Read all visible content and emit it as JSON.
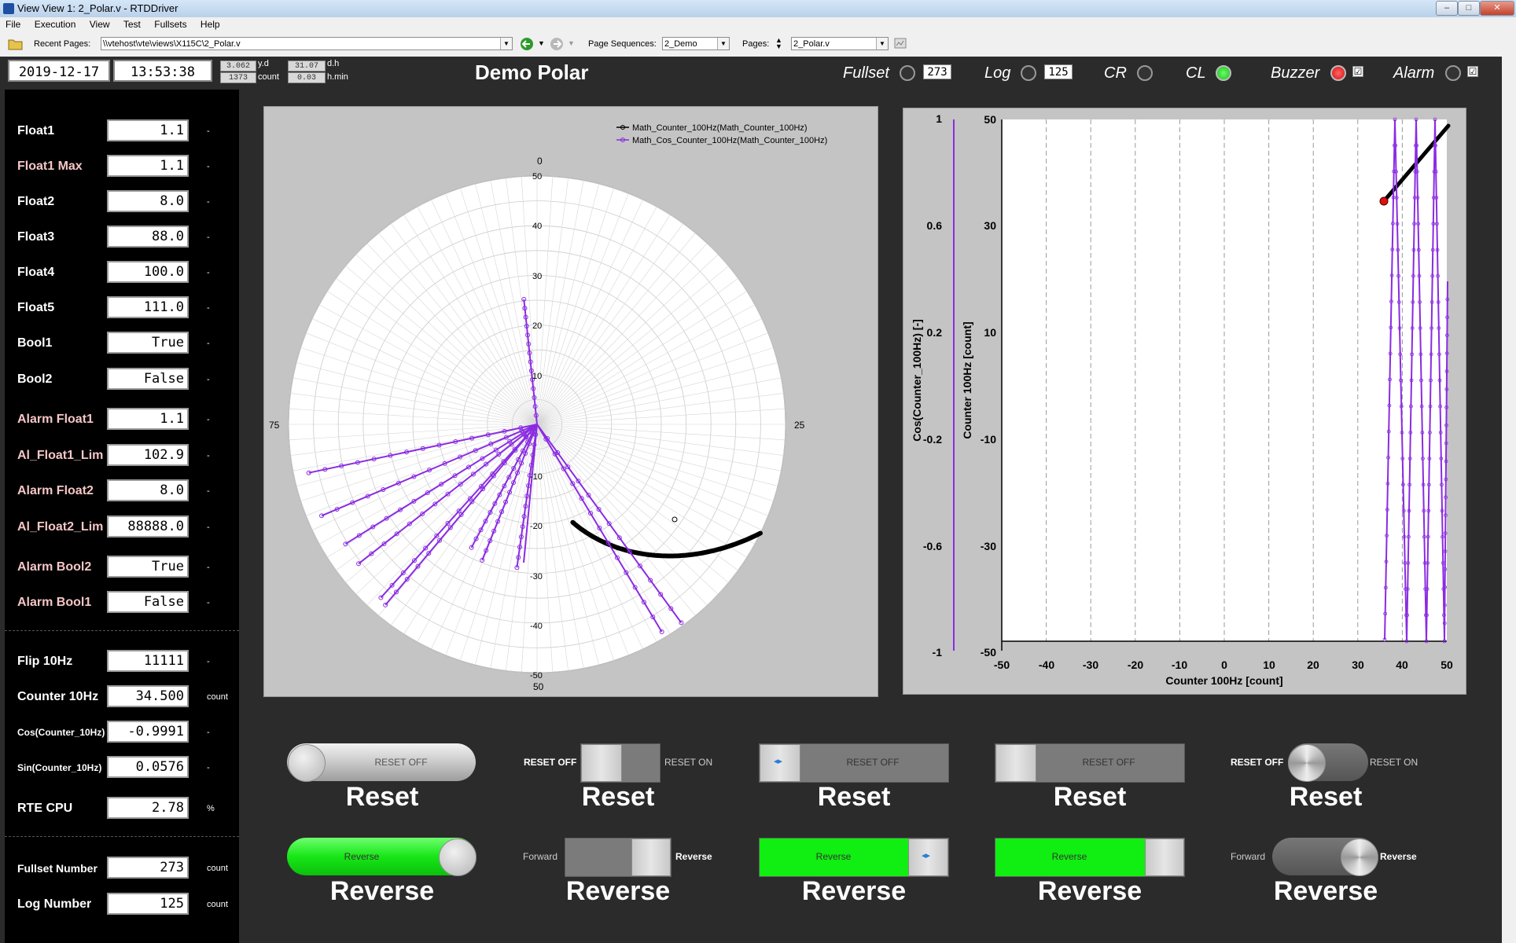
{
  "window": {
    "title": "View View 1: 2_Polar.v - RTDDriver"
  },
  "menu": [
    "File",
    "Execution",
    "View",
    "Test",
    "Fullsets",
    "Help"
  ],
  "toolbar": {
    "recent_label": "Recent Pages:",
    "recent_value": "\\\\vtehost\\vte\\views\\X115C\\2_Polar.v",
    "seq_label": "Page Sequences:",
    "seq_value": "2_Demo",
    "pages_label": "Pages:",
    "pages_value": "2_Polar.v"
  },
  "header": {
    "date": "2019-12-17",
    "time": "13:53:38",
    "yd_value": "3.062",
    "yd_unit": "y.d",
    "count_value": "1373",
    "count_unit": "count",
    "dh_value": "31.07",
    "dh_unit": "d.h",
    "hmin_value": "0.03",
    "hmin_unit": "h.min",
    "title": "Demo Polar",
    "fullset_label": "Fullset",
    "fullset_value": "273",
    "log_label": "Log",
    "log_value": "125",
    "cr_label": "CR",
    "cl_label": "CL",
    "buzzer_label": "Buzzer",
    "alarm_label": "Alarm",
    "buzzer_check": "☑",
    "alarm_check": "☑"
  },
  "left_rows": [
    {
      "label": "Float1",
      "value": "1.1",
      "unit": "-"
    },
    {
      "label": "Float1 Max",
      "value": "1.1",
      "unit": "-"
    },
    {
      "label": "Float2",
      "value": "8.0",
      "unit": "-"
    },
    {
      "label": "Float3",
      "value": "88.0",
      "unit": "-"
    },
    {
      "label": "Float4",
      "value": "100.0",
      "unit": "-"
    },
    {
      "label": "Float5",
      "value": "111.0",
      "unit": "-"
    },
    {
      "label": "Bool1",
      "value": "True",
      "unit": "-"
    },
    {
      "label": "Bool2",
      "value": "False",
      "unit": "-"
    },
    {
      "label": "Alarm Float1",
      "value": "1.1",
      "unit": "-"
    },
    {
      "label": "Al_Float1_Lim",
      "value": "102.9",
      "unit": "-"
    },
    {
      "label": "Alarm Float2",
      "value": "8.0",
      "unit": "-"
    },
    {
      "label": "Al_Float2_Lim",
      "value": "88888.0",
      "unit": "-"
    },
    {
      "label": "Alarm Bool2",
      "value": "True",
      "unit": "-"
    },
    {
      "label": "Alarm Bool1",
      "value": "False",
      "unit": "-"
    },
    {
      "label": "Flip 10Hz",
      "value": "11111",
      "unit": "-"
    },
    {
      "label": "Counter 10Hz",
      "value": "34.500",
      "unit": "count"
    },
    {
      "label": "Cos(Counter_10Hz)",
      "value": "-0.9991",
      "unit": "-"
    },
    {
      "label": "Sin(Counter_10Hz)",
      "value": "0.0576",
      "unit": "-"
    },
    {
      "label": "RTE CPU",
      "value": "2.78",
      "unit": "%"
    },
    {
      "label": "Fullset Number",
      "value": "273",
      "unit": "count"
    },
    {
      "label": "Log Number",
      "value": "125",
      "unit": "count"
    }
  ],
  "polar": {
    "legend": [
      "Math_Counter_100Hz(Math_Counter_100Hz)",
      "Math_Cos_Counter_100Hz(Math_Counter_100Hz)"
    ],
    "angle_labels": [
      "0",
      "25",
      "50",
      "75"
    ],
    "radial_labels": [
      "50",
      "40",
      "30",
      "20",
      "10",
      "-10",
      "-20",
      "-30",
      "-40",
      "-50"
    ]
  },
  "xy": {
    "xlabel": "Counter 100Hz [count]",
    "ylabel_left": "Cos(Counter_100Hz) [-]",
    "ylabel_right": "Counter 100Hz [count]",
    "xticks": [
      "-50",
      "-40",
      "-30",
      "-20",
      "-10",
      "0",
      "10",
      "20",
      "30",
      "40",
      "50"
    ],
    "y1ticks": [
      "1",
      "0.6",
      "0.2",
      "-0.2",
      "-0.6",
      "-1"
    ],
    "y2ticks": [
      "50",
      "30",
      "10",
      "-10",
      "-30",
      "-50"
    ]
  },
  "switches": {
    "title_reset": "Reset",
    "title_reverse": "Reverse",
    "reset_off": "RESET OFF",
    "reset_on": "RESET ON",
    "reverse": "Reverse",
    "forward": "Forward"
  },
  "colors": {
    "purple": "#8a2be2",
    "green": "#11ee11",
    "led_red": "#e01010",
    "led_green": "#22cc22"
  }
}
